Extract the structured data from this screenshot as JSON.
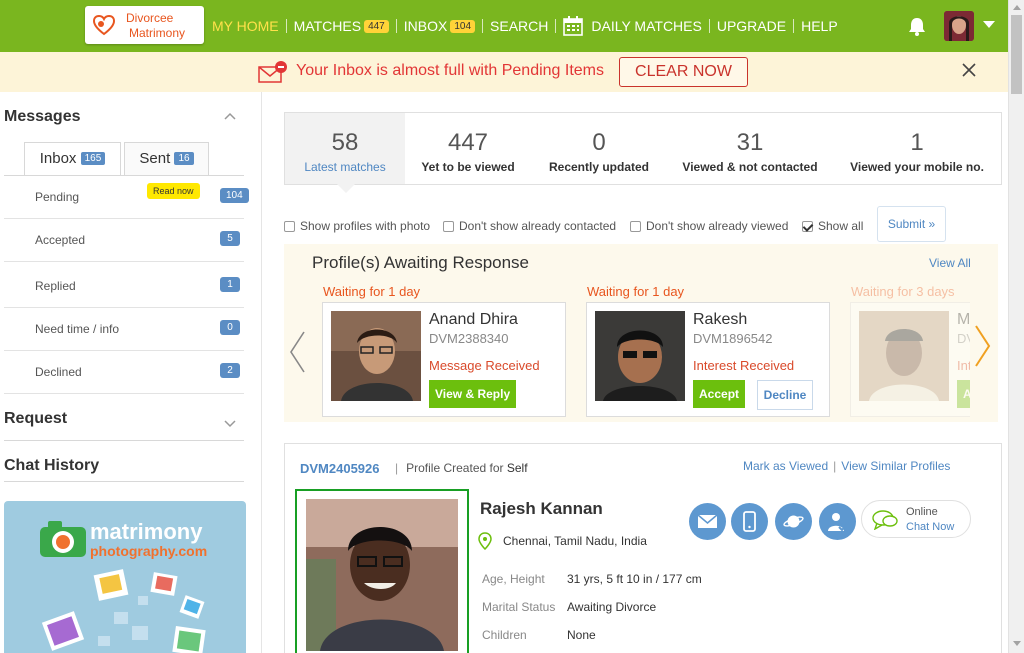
{
  "brand": {
    "line1": "Divorcee",
    "line2": "Matrimony"
  },
  "nav": {
    "my_home": "MY HOME",
    "matches": "MATCHES",
    "matches_count": "447",
    "inbox": "INBOX",
    "inbox_count": "104",
    "search": "SEARCH",
    "daily_matches": "DAILY MATCHES",
    "upgrade": "UPGRADE",
    "help": "HELP"
  },
  "alert": {
    "message": "Your Inbox is almost full with Pending Items",
    "button": "CLEAR NOW"
  },
  "sidebar": {
    "messages_heading": "Messages",
    "tabs": [
      {
        "label": "Inbox",
        "count": "165"
      },
      {
        "label": "Sent",
        "count": "16"
      }
    ],
    "read_now": "Read now",
    "items": [
      {
        "label": "Pending",
        "count": "104"
      },
      {
        "label": "Accepted",
        "count": "5"
      },
      {
        "label": "Replied",
        "count": "1"
      },
      {
        "label": "Need time / info",
        "count": "0"
      },
      {
        "label": "Declined",
        "count": "2"
      }
    ],
    "request_heading": "Request",
    "chat_heading": "Chat History",
    "promo": {
      "line1": "matrimony",
      "line2": "photography.com"
    }
  },
  "stats": [
    {
      "num": "58",
      "label": "Latest matches"
    },
    {
      "num": "447",
      "label": "Yet to be viewed"
    },
    {
      "num": "0",
      "label": "Recently updated"
    },
    {
      "num": "31",
      "label": "Viewed & not contacted"
    },
    {
      "num": "1",
      "label": "Viewed your mobile no."
    }
  ],
  "filters": {
    "photo": "Show profiles with photo",
    "contacted": "Don't show already contacted",
    "viewed": "Don't show already viewed",
    "show_all": "Show all",
    "submit": "Submit »"
  },
  "awaiting": {
    "title": "Profile(s) Awaiting Response",
    "view_all": "View All",
    "cards": [
      {
        "wait": "Waiting for 1 day",
        "name": "Anand Dhira",
        "id": "DVM2388340",
        "status": "Message Received",
        "primary": "View & Reply"
      },
      {
        "wait": "Waiting for 1 day",
        "name": "Rakesh",
        "id": "DVM1896542",
        "status": "Interest Received",
        "primary": "Accept",
        "secondary": "Decline"
      },
      {
        "wait": "Waiting for 3 days",
        "name": "M",
        "id": "DV",
        "status": "Int",
        "primary": "A"
      }
    ]
  },
  "profile": {
    "id": "DVM2405926",
    "created_for_label": "Profile Created for",
    "created_for": "Self",
    "mark_viewed": "Mark as Viewed",
    "view_similar": "View Similar Profiles",
    "name": "Rajesh Kannan",
    "location": "Chennai, Tamil Nadu, India",
    "online": "Online",
    "chat_now": "Chat Now",
    "details": [
      {
        "key": "Age, Height",
        "value": "31 yrs, 5 ft 10 in / 177 cm"
      },
      {
        "key": "Marital Status",
        "value": "Awaiting Divorce"
      },
      {
        "key": "Children",
        "value": "None"
      }
    ]
  },
  "colors": {
    "brand_green": "#7ab61f",
    "link_blue": "#4f87c2",
    "alert_red": "#e23636",
    "accept_green": "#6cbf0d"
  }
}
